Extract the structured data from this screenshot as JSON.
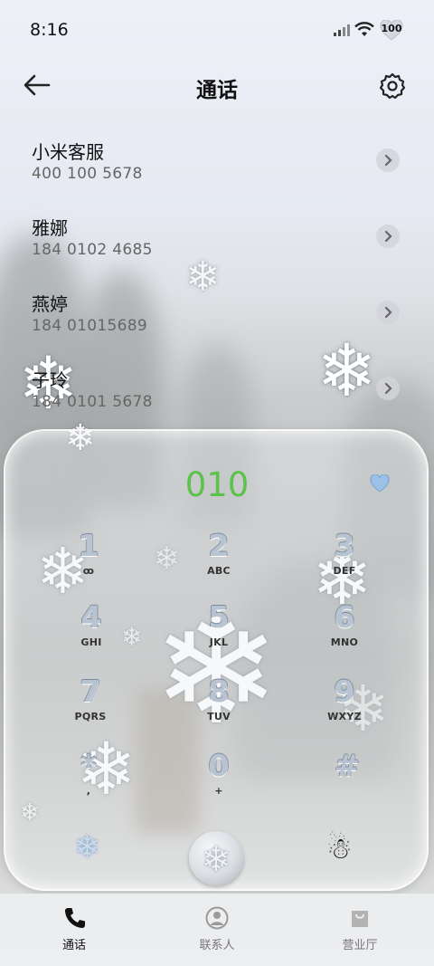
{
  "status_bar": {
    "time": "8:16",
    "battery": "100"
  },
  "header": {
    "title": "通话"
  },
  "recents": [
    {
      "name": "小米客服",
      "number": "400 100 5678"
    },
    {
      "name": "雅娜",
      "number": "184 0102 4685"
    },
    {
      "name": "燕婷",
      "number": "184 01015689"
    },
    {
      "name": "子玲",
      "number": "184 0101 5678"
    }
  ],
  "dialer": {
    "entered": "010",
    "keys": [
      {
        "digit": "1",
        "letters": "ꝏ"
      },
      {
        "digit": "2",
        "letters": "ABC"
      },
      {
        "digit": "3",
        "letters": "DEF"
      },
      {
        "digit": "4",
        "letters": "GHI"
      },
      {
        "digit": "5",
        "letters": "JKL"
      },
      {
        "digit": "6",
        "letters": "MNO"
      },
      {
        "digit": "7",
        "letters": "PQRS"
      },
      {
        "digit": "8",
        "letters": "TUV"
      },
      {
        "digit": "9",
        "letters": "WXYZ"
      },
      {
        "digit": "*",
        "letters": ","
      },
      {
        "digit": "0",
        "letters": "+"
      },
      {
        "digit": "#",
        "letters": ""
      }
    ]
  },
  "nav": {
    "tabs": [
      {
        "label": "通话"
      },
      {
        "label": "联系人"
      },
      {
        "label": "营业厅"
      }
    ]
  },
  "colors": {
    "accent_green": "#5cc24a",
    "heart_blue": "#9cc1e8"
  },
  "icons": [
    "back-arrow-icon",
    "settings-gear-icon",
    "chevron-right-icon",
    "heart-icon",
    "snowflake-icon",
    "snowman-icon",
    "phone-icon",
    "contact-icon",
    "shop-bag-icon"
  ]
}
